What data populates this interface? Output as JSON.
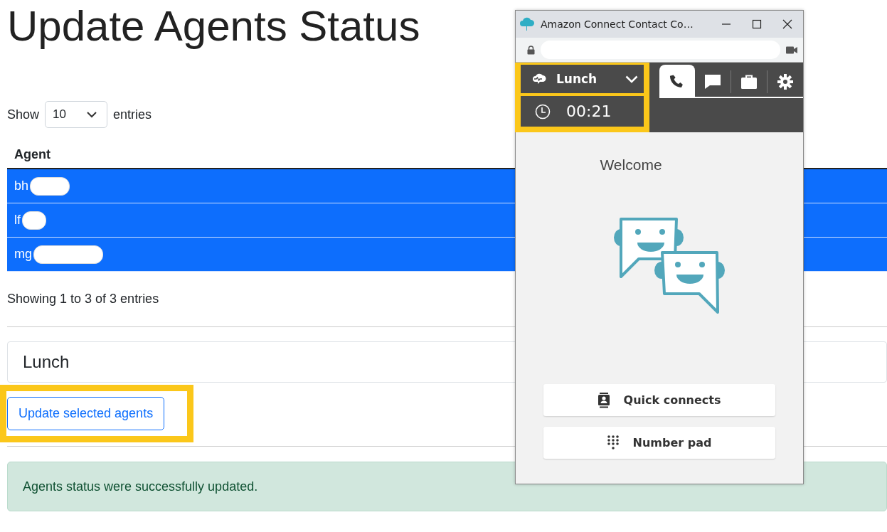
{
  "page": {
    "title": "Update Agents Status",
    "length_menu": {
      "label_before": "Show",
      "value": "10",
      "label_after": "entries"
    },
    "table": {
      "columns": [
        "Agent"
      ],
      "rows": [
        {
          "agent": "bh",
          "selected": true
        },
        {
          "agent": "lf",
          "selected": true
        },
        {
          "agent": "mg",
          "selected": true
        }
      ]
    },
    "info": "Showing 1 to 3 of 3 entries",
    "status_field": {
      "value": "Lunch"
    },
    "update_button": "Update selected agents",
    "alert": "Agents status were successfully updated."
  },
  "ccp_window": {
    "title": "Amazon Connect Contact Co…",
    "status": {
      "label": "Lunch",
      "timer": "00:21"
    },
    "tabs": [
      {
        "kind": "phone",
        "selected": true
      },
      {
        "kind": "chat",
        "selected": false
      },
      {
        "kind": "briefcase",
        "selected": false
      },
      {
        "kind": "settings",
        "selected": false
      }
    ],
    "welcome": "Welcome",
    "buttons": [
      {
        "kind": "quick-connects",
        "label": "Quick connects"
      },
      {
        "kind": "number-pad",
        "label": "Number pad"
      }
    ]
  }
}
